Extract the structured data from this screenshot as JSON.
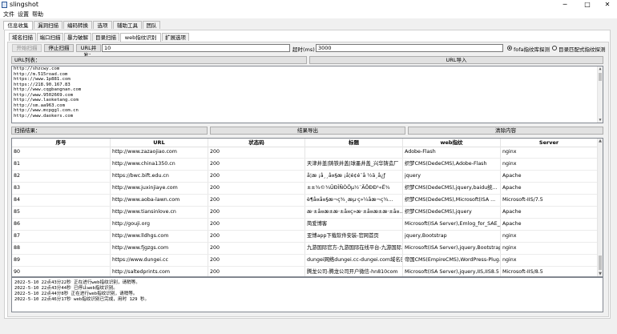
{
  "window": {
    "title": "slingshot",
    "minimize": "─",
    "maximize": "□",
    "close": "✕"
  },
  "menu": [
    "文件",
    "设置",
    "帮助"
  ],
  "main_tabs": [
    "信息收集",
    "漏洞扫描",
    "编码转换",
    "选项",
    "辅助工具",
    "团队"
  ],
  "sub_tabs": [
    "域名扫描",
    "端口扫描",
    "暴力破解",
    "目录扫描",
    "web指纹识别",
    "扩展选项"
  ],
  "toolbar": {
    "start_label": "开始扫描",
    "stop_label": "停止扫描",
    "concurrency_label": "URL并发：",
    "concurrency_value": "10",
    "timeout_label": "超时(ms)：",
    "timeout_value": "3000",
    "radio_fofa_label": "fofa指纹库探测",
    "radio_dir_label": "目录匹配式指纹探测",
    "radio_fofa_checked": true
  },
  "url_section": {
    "list_label": "URL列表：",
    "import_label": "URL导入",
    "urls": [
      "http://shzcwy.com",
      "http://m.515road.com",
      "https://www.1p881.com",
      "https://218.90.167.83",
      "http://www.cqgbangnan.com",
      "http://www.9502669.com",
      "http://www.laoketang.com",
      "http://sm.aa963.com",
      "http://www.mcpggl.com.cn",
      "http://www.daokers.com"
    ]
  },
  "results_section": {
    "label": "扫描结果：",
    "export_label": "结果导出",
    "clear_label": "清除内容",
    "columns": [
      "序号",
      "URL",
      "状态码",
      "标题",
      "web指纹",
      "Server"
    ],
    "rows": [
      [
        "80",
        "http://www.zazaojiao.com",
        "200",
        "",
        "Adobe-Flash",
        "nginx"
      ],
      [
        "81",
        "http://www.china1350.cn",
        "200",
        "天津井盖|铸铁井盖|球墨井盖_兴华铸造厂",
        "织梦CMS(DedeCMS),Adobe-Flash",
        "nginx"
      ],
      [
        "82",
        "https://bwc.bift.edu.cn",
        "200",
        "å­¦æ ¡å¸¸å¤§æ ¡å¦é¢é¨å ½ä¸­å¿ƒ",
        "jquery",
        "Apache"
      ],
      [
        "83",
        "http://www.juxinjiaye.com",
        "200",
        "±±¾©¾ÛÐÎÑÒÕµ½¨ÃÔÐÐ¹«Ë¾",
        "织梦CMS(DedeCMS),jquery,baidu统...",
        "Apache"
      ],
      [
        "84",
        "http://www.aoba-lawn.com",
        "200",
        "è¶å¤å¤§æ¬ç¾¸æµ·ç»¼åæ¬ç¾...",
        "织梦CMS(DedeCMS),Microsoft(ISA ...",
        "Microsoft-IIS/7.5"
      ],
      [
        "85",
        "http://www.tiansinlove.cn",
        "200",
        "æ·±å¤æ±æ·±å¤ç»æ·±å¤æ±æ·±å¤...",
        "织梦CMS(DedeCMS),jquery",
        "Apache"
      ],
      [
        "86",
        "http://gouji.org",
        "200",
        "简爱博客",
        "Microsoft(ISA Server),Emlog_for_SAE_...",
        "Apache"
      ],
      [
        "87",
        "http://www.lldhgs.com",
        "200",
        "亚博app下载软件安装-官网首页",
        "jquery,Bootstrap",
        "nginx"
      ],
      [
        "88",
        "http://www.fjgzgs.com",
        "200",
        "九游国际官方-九游国际在线平台-九游国际...",
        "Microsoft(ISA Server),jquery,Bootstrap...",
        "nginx"
      ],
      [
        "89",
        "https://www.dungei.cc",
        "200",
        "dungei网络dungei.cc-dungei.com域名已更...",
        "帝国CMS(EmpireCMS),WordPress-Plug...",
        "nginx"
      ],
      [
        "90",
        "http://saltedprints.com",
        "200",
        "腾龙公司-腾龙公司开户微信-hn810com",
        "Microsoft(ISA Server),jquery,IIS,IIS8.5",
        "Microsoft-IIS/8.5"
      ]
    ]
  },
  "log": [
    "2022-5-10 22点43分22秒 正在进行web指纹识别，请稍等。",
    "2022-5-10 22点43分44秒 已停止web指纹识别。",
    "2022-5-10 22点44分8秒 正在进行web指纹识别，请稍等。",
    "2022-5-10 22点46分17秒 web指纹识别已完成，用时 129 秒。"
  ]
}
